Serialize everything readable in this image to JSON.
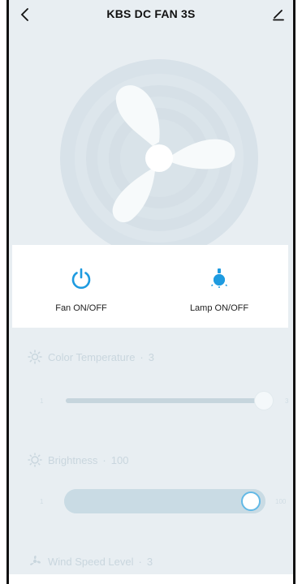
{
  "header": {
    "title": "KBS DC FAN 3S",
    "back_icon": "chevron-left-icon",
    "edit_icon": "pencil-icon"
  },
  "controls": {
    "fan": {
      "label": "Fan ON/OFF",
      "icon": "power-icon",
      "color": "#1e9be0"
    },
    "lamp": {
      "label": "Lamp ON/OFF",
      "icon": "bulb-icon",
      "color": "#1e9be0"
    }
  },
  "color_temperature": {
    "label": "Color Temperature",
    "value": "3",
    "min": "1",
    "max": "3",
    "level": 1.0,
    "icon": "sun-icon"
  },
  "brightness": {
    "label": "Brightness",
    "value": "100",
    "min": "1",
    "max": "100",
    "level": 1.0,
    "icon": "brightness-icon"
  },
  "wind_speed": {
    "label": "Wind Speed Level",
    "value": "3",
    "icon": "fan-small-icon"
  },
  "colors": {
    "background": "#e8eef2",
    "accent": "#1e9be0",
    "disabled_text": "#c9d6de"
  }
}
